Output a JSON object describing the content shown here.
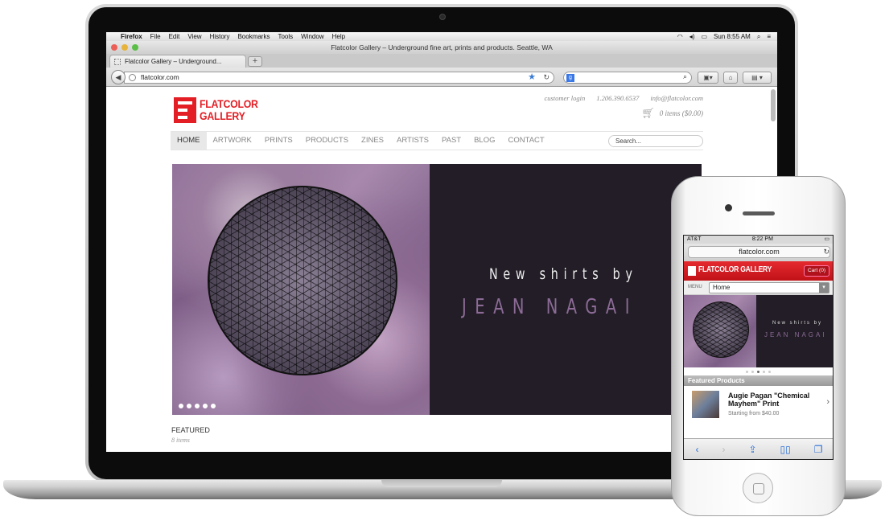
{
  "mac_menubar": {
    "items": [
      "Firefox",
      "File",
      "Edit",
      "View",
      "History",
      "Bookmarks",
      "Tools",
      "Window",
      "Help"
    ],
    "clock": "Sun 8:55 AM"
  },
  "browser": {
    "window_title": "Flatcolor Gallery – Underground fine art, prints and products. Seattle, WA",
    "tab_title": "Flatcolor Gallery – Underground...",
    "new_tab": "+",
    "url": "flatcolor.com"
  },
  "site": {
    "logo_line1": "FLATCOLOR",
    "logo_line2": "GALLERY",
    "customer_login": "customer login",
    "phone": "1.206.390.6537",
    "email": "info@flatcolor.com",
    "cart": "0 items ($0.00)",
    "nav": [
      "HOME",
      "ARTWORK",
      "PRINTS",
      "PRODUCTS",
      "ZINES",
      "ARTISTS",
      "PAST",
      "BLOG",
      "CONTACT"
    ],
    "search_placeholder": "Search...",
    "hero_line1": "New shirts by",
    "hero_line2": "JEAN NAGAI",
    "featured_title": "FEATURED",
    "featured_count": "8 items"
  },
  "phone": {
    "carrier": "AT&T",
    "time": "8:22 PM",
    "url": "flatcolor.com",
    "brand": "FLATCOLOR GALLERY",
    "cart": "Cart (0)",
    "menu_label": "MENU",
    "menu_value": "Home",
    "hero_line1": "New shirts by",
    "hero_line2": "JEAN NAGAI",
    "featured_header": "Featured Products",
    "product_title": "Augie Pagan \"Chemical Mayhem\" Print",
    "product_price": "Starting from $40.00"
  },
  "colors": {
    "brand_red": "#e31e24",
    "hero_purple": "#8c6b97",
    "hero_dark": "#221d26"
  }
}
